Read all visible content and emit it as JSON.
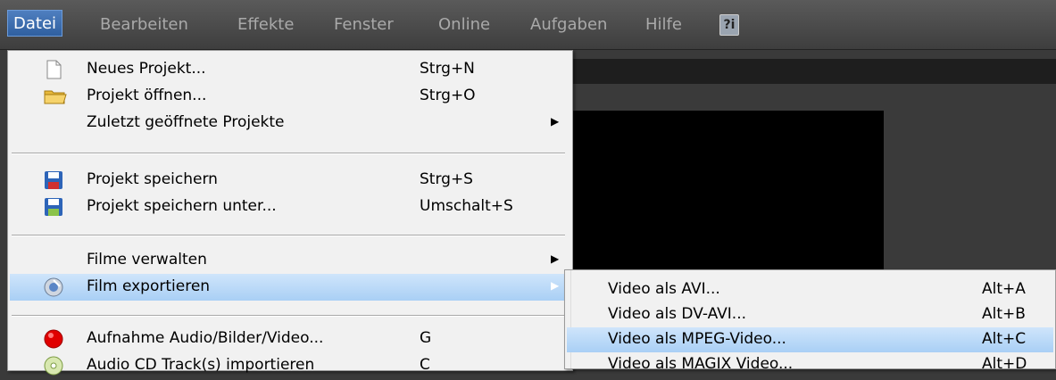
{
  "menubar": {
    "items": [
      "Datei",
      "Bearbeiten",
      "Effekte",
      "Fenster",
      "Online",
      "Aufgaben",
      "Hilfe"
    ],
    "help_icon_label": "?i"
  },
  "menu": {
    "items": [
      {
        "label": "Neues Projekt...",
        "shortcut": "Strg+N",
        "icon": "new-document-icon"
      },
      {
        "label": "Projekt öffnen...",
        "shortcut": "Strg+O",
        "icon": "folder-icon"
      },
      {
        "label": "Zuletzt geöffnete Projekte",
        "shortcut": "",
        "icon": ""
      },
      {
        "label": "Projekt speichern",
        "shortcut": "Strg+S",
        "icon": "save-icon"
      },
      {
        "label": "Projekt speichern unter...",
        "shortcut": "Umschalt+S",
        "icon": "save-as-icon"
      },
      {
        "label": "Filme verwalten",
        "shortcut": "",
        "icon": ""
      },
      {
        "label": "Film exportieren",
        "shortcut": "",
        "icon": "export-icon"
      },
      {
        "label": "Aufnahme Audio/Bilder/Video...",
        "shortcut": "G",
        "icon": "record-icon"
      },
      {
        "label": "Audio CD Track(s) importieren",
        "shortcut": "C",
        "icon": "audio-cd-icon"
      }
    ]
  },
  "submenu": {
    "items": [
      {
        "label": "Video als AVI...",
        "shortcut": "Alt+A"
      },
      {
        "label": "Video als DV-AVI...",
        "shortcut": "Alt+B"
      },
      {
        "label": "Video als MPEG-Video...",
        "shortcut": "Alt+C"
      },
      {
        "label": "Video als MAGIX Video...",
        "shortcut": "Alt+D"
      }
    ]
  },
  "colors": {
    "highlight": "#a9cff5",
    "active_menu": "#3a6aaa",
    "record": "#e00000"
  }
}
